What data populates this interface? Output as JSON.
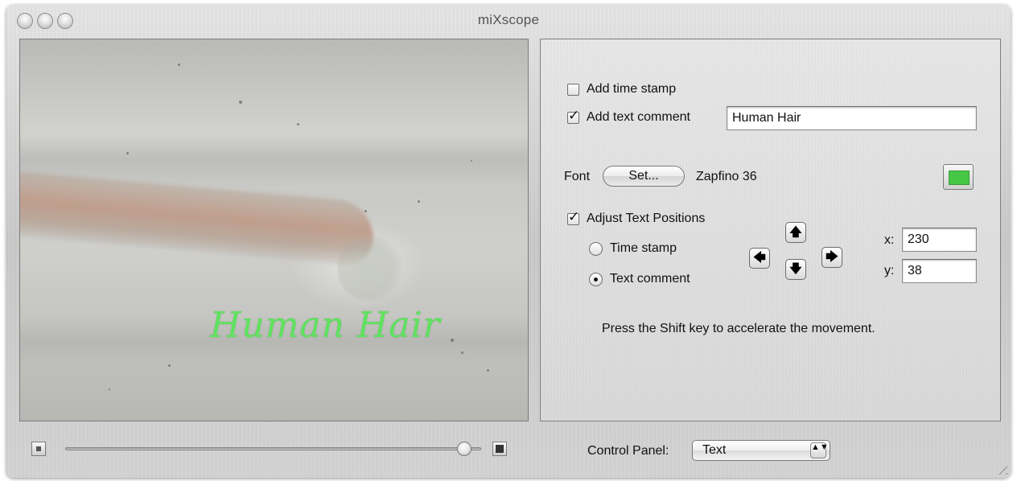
{
  "window": {
    "title": "miXscope"
  },
  "preview": {
    "overlay_text": "Human Hair",
    "overlay_color": "#5fe35f"
  },
  "panel": {
    "time_stamp": {
      "label": "Add time stamp",
      "checked": false
    },
    "text_comment": {
      "label": "Add text comment",
      "checked": true,
      "value": "Human Hair"
    },
    "font": {
      "label": "Font",
      "button_label": "Set...",
      "current": "Zapfino 36",
      "color": "#45c845"
    },
    "adjust": {
      "label": "Adjust Text Positions",
      "checked": true
    },
    "radios": [
      {
        "label": "Time stamp",
        "selected": false
      },
      {
        "label": "Text comment",
        "selected": true
      }
    ],
    "arrows": {
      "up": "🡅",
      "down": "🡇",
      "left": "🡄",
      "right": "🡆"
    },
    "x": {
      "label": "x:",
      "value": "230"
    },
    "y": {
      "label": "y:",
      "value": "38"
    },
    "hint": "Press the Shift key to accelerate the movement."
  },
  "bottom": {
    "zoom_level": 0.96,
    "control_panel_label": "Control Panel:",
    "control_panel_value": "Text",
    "stepper_glyph": "▲▼"
  }
}
